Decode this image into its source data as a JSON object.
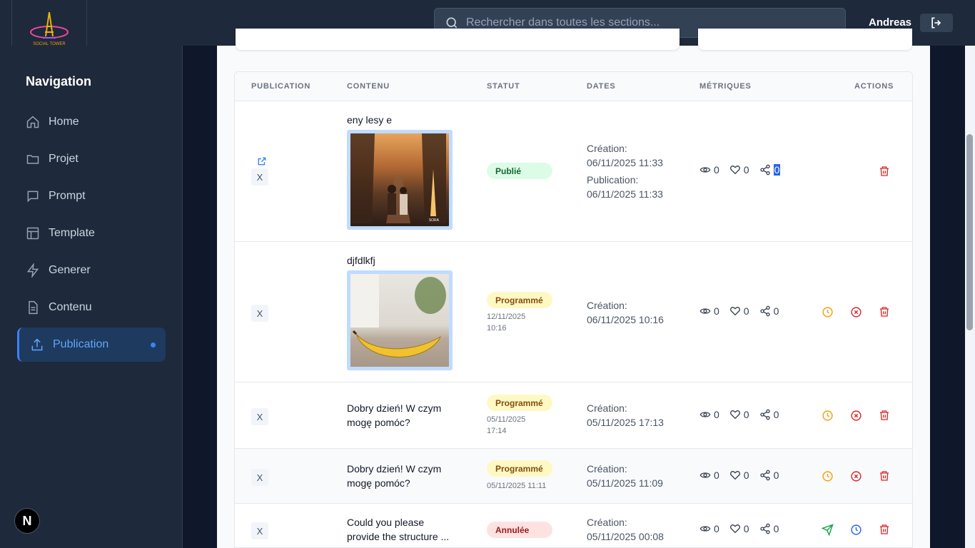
{
  "brand": {
    "logo_text": "SOCIAL TOWER"
  },
  "header": {
    "search_placeholder": "Rechercher dans toutes les sections...",
    "username": "Andreas"
  },
  "sidebar": {
    "title": "Navigation",
    "items": [
      {
        "label": "Home",
        "icon": "home-icon"
      },
      {
        "label": "Projet",
        "icon": "folder-icon"
      },
      {
        "label": "Prompt",
        "icon": "message-icon"
      },
      {
        "label": "Template",
        "icon": "layout-icon"
      },
      {
        "label": "Generer",
        "icon": "zap-icon"
      },
      {
        "label": "Contenu",
        "icon": "file-text-icon"
      },
      {
        "label": "Publication",
        "icon": "upload-icon",
        "active": true
      }
    ],
    "footer_badge": "N"
  },
  "table": {
    "columns": [
      "PUBLICATION",
      "CONTENU",
      "STATUT",
      "DATES",
      "MÉTRIQUES",
      "ACTIONS"
    ],
    "rows": [
      {
        "x": "X",
        "title": "eny lesy e",
        "thumb_caption": "SORA",
        "status": "Publié",
        "dates_line1": "Création:",
        "dates_line2": "06/11/2025 11:33",
        "dates_line3": "Publication:",
        "dates_line4": "06/11/2025 11:33",
        "views": "0",
        "likes": "0",
        "shares": "0"
      },
      {
        "x": "X",
        "title": "djfdlkfj",
        "status": "Programmé",
        "sched_line1": "12/11/2025",
        "sched_line2": "10:16",
        "dates_line1": "Création:",
        "dates_line2": "06/11/2025 10:16",
        "views": "0",
        "likes": "0",
        "shares": "0"
      },
      {
        "x": "X",
        "content_line1": "Dobry dzień! W czym",
        "content_line2": "mogę pomóc?",
        "status": "Programmé",
        "sched_line1": "05/11/2025",
        "sched_line2": "17:14",
        "dates_line1": "Création:",
        "dates_line2": "05/11/2025 17:13",
        "views": "0",
        "likes": "0",
        "shares": "0"
      },
      {
        "x": "X",
        "content_line1": "Dobry dzień! W czym",
        "content_line2": "mogę pomóc?",
        "status": "Programmé",
        "sched_line1": "05/11/2025 11:11",
        "dates_line1": "Création:",
        "dates_line2": "05/11/2025 11:09",
        "views": "0",
        "likes": "0",
        "shares": "0"
      },
      {
        "x": "X",
        "content_line1": "Could you please",
        "content_line2": "provide the structure ...",
        "status": "Annulée",
        "dates_line1": "Création:",
        "dates_line2": "05/11/2025 00:08",
        "views": "0",
        "likes": "0",
        "shares": "0"
      }
    ]
  },
  "colors": {
    "accent": "#3b82f6",
    "published": "#166534",
    "scheduled": "#854d0e",
    "cancelled": "#991b1b",
    "delete": "#dc2626",
    "clock_orange": "#f59e0b"
  }
}
